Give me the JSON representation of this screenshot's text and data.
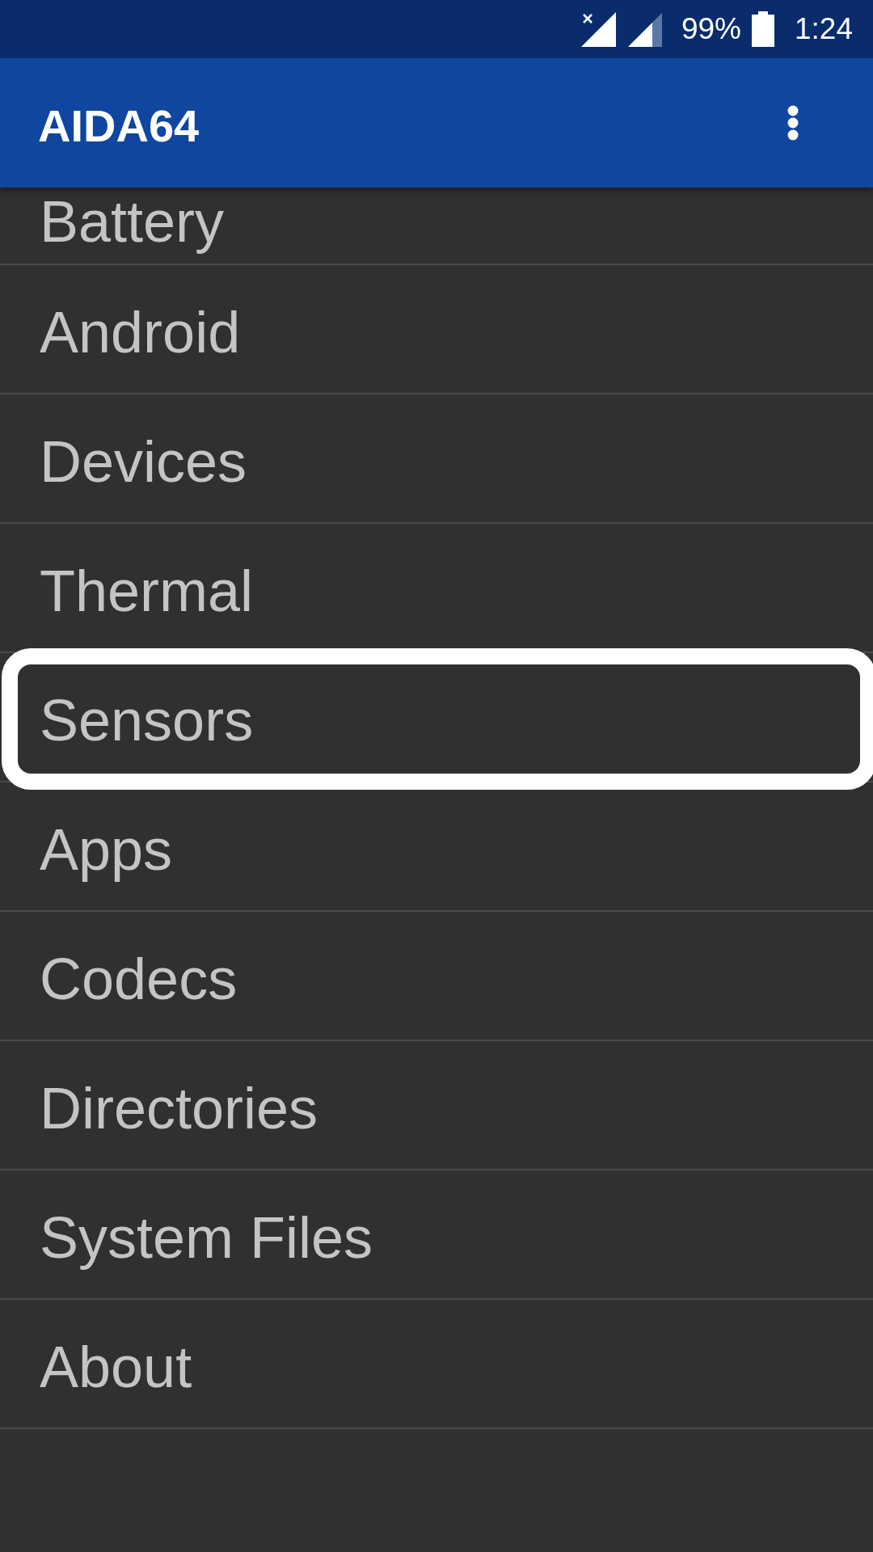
{
  "status_bar": {
    "battery": "99%",
    "time": "1:24"
  },
  "app_bar": {
    "title": "AIDA64"
  },
  "menu": {
    "items": [
      {
        "label": "Battery",
        "highlighted": false
      },
      {
        "label": "Android",
        "highlighted": false
      },
      {
        "label": "Devices",
        "highlighted": false
      },
      {
        "label": "Thermal",
        "highlighted": false
      },
      {
        "label": "Sensors",
        "highlighted": true
      },
      {
        "label": "Apps",
        "highlighted": false
      },
      {
        "label": "Codecs",
        "highlighted": false
      },
      {
        "label": "Directories",
        "highlighted": false
      },
      {
        "label": "System Files",
        "highlighted": false
      },
      {
        "label": "About",
        "highlighted": false
      }
    ]
  }
}
